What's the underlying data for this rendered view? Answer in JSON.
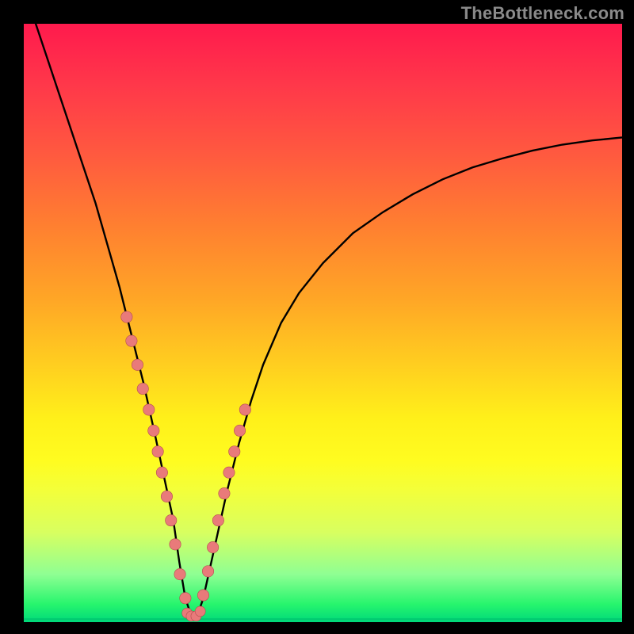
{
  "attribution": "TheBottleneck.com",
  "colors": {
    "curve": "#000000",
    "marker_fill": "#e97a7a",
    "marker_stroke": "#b34f4f",
    "green_line": "#00c870"
  },
  "chart_data": {
    "type": "line",
    "title": "",
    "xlabel": "",
    "ylabel": "",
    "xlim": [
      0,
      100
    ],
    "ylim": [
      0,
      100
    ],
    "curve": {
      "x": [
        0,
        2,
        4,
        6,
        8,
        10,
        12,
        14,
        16,
        18,
        20,
        22,
        23.5,
        25,
        26,
        27,
        28,
        29,
        30,
        32,
        34,
        36,
        38,
        40,
        43,
        46,
        50,
        55,
        60,
        65,
        70,
        75,
        80,
        85,
        90,
        95,
        100
      ],
      "y": [
        105,
        100,
        94,
        88,
        82,
        76,
        70,
        63,
        56,
        48,
        40,
        31,
        24,
        17,
        10,
        4,
        1,
        1,
        4,
        13,
        22,
        30,
        37,
        43,
        50,
        55,
        60,
        65,
        68.5,
        71.5,
        74,
        76,
        77.5,
        78.8,
        79.8,
        80.5,
        81
      ]
    },
    "points_left": {
      "x": [
        17.2,
        18.0,
        19.0,
        19.9,
        20.9,
        21.7,
        22.4,
        23.1,
        23.9,
        24.6,
        25.3,
        26.1,
        27.0
      ],
      "y": [
        51.0,
        47.0,
        43.0,
        39.0,
        35.5,
        32.0,
        28.5,
        25.0,
        21.0,
        17.0,
        13.0,
        8.0,
        4.0
      ]
    },
    "points_right": {
      "x": [
        30.0,
        30.8,
        31.6,
        32.5,
        33.5,
        34.3,
        35.2,
        36.1,
        37.0
      ],
      "y": [
        4.5,
        8.5,
        12.5,
        17.0,
        21.5,
        25.0,
        28.5,
        32.0,
        35.5
      ]
    },
    "points_bottom": {
      "x": [
        27.3,
        28.0,
        28.8,
        29.5
      ],
      "y": [
        1.5,
        1.0,
        1.0,
        1.8
      ]
    },
    "bottom_line_y": 0.5
  }
}
